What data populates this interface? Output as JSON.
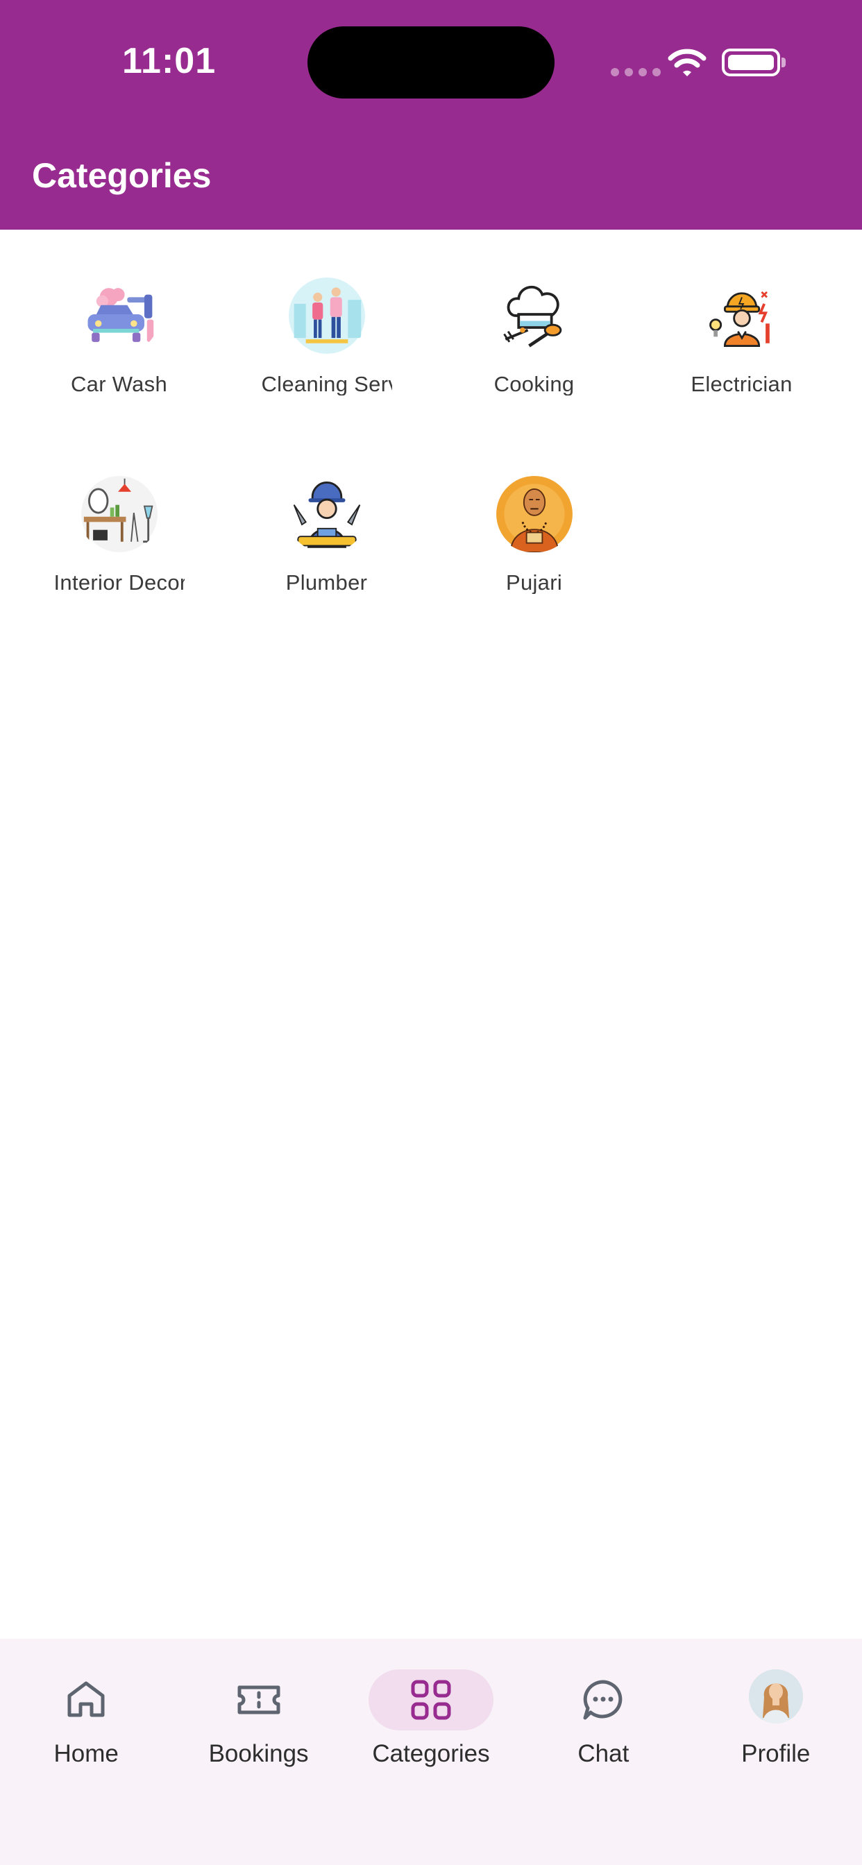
{
  "status_bar": {
    "time": "11:01"
  },
  "header": {
    "title": "Categories"
  },
  "categories": [
    {
      "label": "Car Wash",
      "icon": "car-wash-icon"
    },
    {
      "label": "Cleaning Services",
      "icon": "cleaning-services-icon"
    },
    {
      "label": "Cooking",
      "icon": "chef-hat-icon"
    },
    {
      "label": "Electrician",
      "icon": "electrician-icon"
    },
    {
      "label": "Interior Decor",
      "icon": "interior-decor-icon"
    },
    {
      "label": "Plumber",
      "icon": "plumber-icon"
    },
    {
      "label": "Pujari",
      "icon": "pujari-icon"
    }
  ],
  "bottom_nav": {
    "items": [
      {
        "label": "Home",
        "icon": "home-icon"
      },
      {
        "label": "Bookings",
        "icon": "ticket-icon"
      },
      {
        "label": "Categories",
        "icon": "grid-icon",
        "active": true
      },
      {
        "label": "Chat",
        "icon": "chat-bubble-icon"
      },
      {
        "label": "Profile",
        "icon": "avatar"
      }
    ]
  },
  "colors": {
    "primary": "#982b8f",
    "nav_background": "#f9f3f9",
    "active_pill": "#f1dded",
    "icon_gray": "#5f6570"
  }
}
